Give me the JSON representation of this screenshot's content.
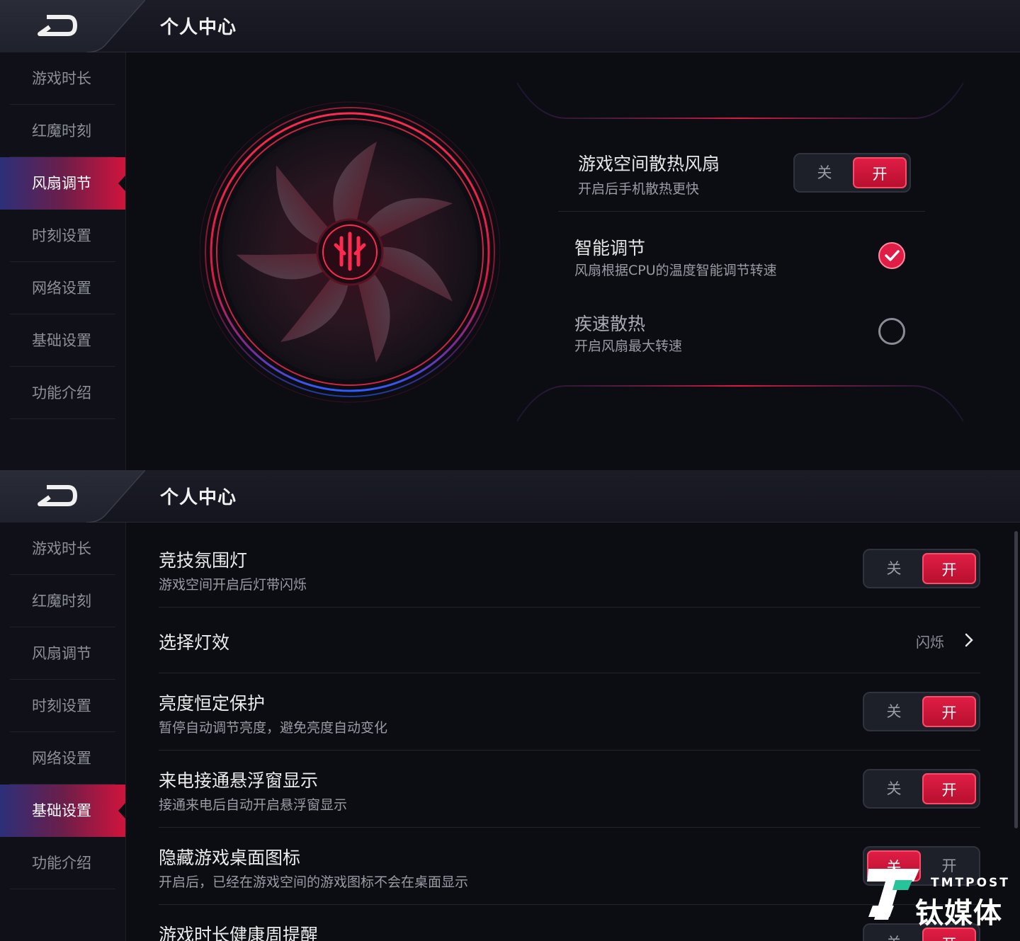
{
  "colors": {
    "accent": "#e01d45",
    "accent_blue": "#3a4fd6",
    "background": "#0c0c13",
    "sidebar_active_from": "#2c2f7a",
    "sidebar_active_to": "#d0143c"
  },
  "panel1": {
    "header": {
      "title": "个人中心",
      "back_icon": "back-arrow-icon"
    },
    "sidebar": {
      "items": [
        "游戏时长",
        "红魔时刻",
        "风扇调节",
        "时刻设置",
        "网络设置",
        "基础设置",
        "功能介绍"
      ],
      "active": "风扇调节"
    },
    "fan": {
      "toggle": {
        "title": "游戏空间散热风扇",
        "subtitle": "开启后手机散热更快",
        "off_label": "关",
        "on_label": "开",
        "state": "on"
      },
      "smart": {
        "title": "智能调节",
        "subtitle": "风扇根据CPU的温度智能调节转速",
        "selected": true
      },
      "turbo": {
        "title": "疾速散热",
        "subtitle": "开启风扇最大转速",
        "selected": false
      }
    }
  },
  "panel2": {
    "header": {
      "title": "个人中心",
      "back_icon": "back-arrow-icon"
    },
    "sidebar": {
      "items": [
        "游戏时长",
        "红魔时刻",
        "风扇调节",
        "时刻设置",
        "网络设置",
        "基础设置",
        "功能介绍"
      ],
      "active": "基础设置"
    },
    "rows": {
      "ambient": {
        "title": "竞技氛围灯",
        "subtitle": "游戏空间开启后灯带闪烁",
        "off_label": "关",
        "on_label": "开",
        "state": "on"
      },
      "effect": {
        "title": "选择灯效",
        "value": "闪烁"
      },
      "brightness": {
        "title": "亮度恒定保护",
        "subtitle": "暂停自动调节亮度，避免亮度自动变化",
        "off_label": "关",
        "on_label": "开",
        "state": "on"
      },
      "call": {
        "title": "来电接通悬浮窗显示",
        "subtitle": "接通来电后自动开启悬浮窗显示",
        "off_label": "关",
        "on_label": "开",
        "state": "on"
      },
      "hide": {
        "title": "隐藏游戏桌面图标",
        "subtitle": "开启后，已经在游戏空间的游戏图标不会在桌面显示",
        "off_label": "关",
        "on_label": "开",
        "state": "off"
      },
      "health": {
        "title": "游戏时长健康周提醒",
        "off_label": "关",
        "on_label": "开"
      }
    }
  },
  "watermark": {
    "en": "TMTPOST",
    "cn": "钛媒体"
  }
}
